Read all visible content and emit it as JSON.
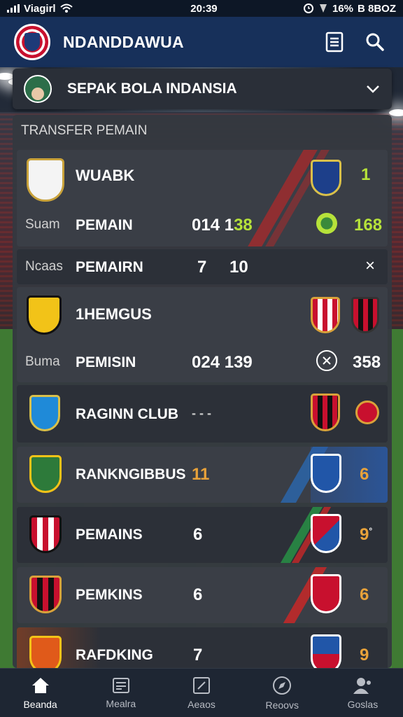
{
  "status_bar": {
    "carrier": "Viagirl",
    "time": "20:39",
    "battery": "16%",
    "right_text": "B 8BOZ"
  },
  "app": {
    "title": "NDANDDAWUA",
    "icons": [
      "clipboard-icon",
      "search-icon"
    ]
  },
  "league": {
    "name": "SEPAK BOLA INDANSIA"
  },
  "section": {
    "title": "TRANSFER PEMAIN"
  },
  "cards": [
    {
      "name": "WUABK",
      "right_value": "1",
      "label_left": "Suam",
      "label": "PEMAIN",
      "mid_a": "014 1",
      "mid_b": "38",
      "right_value2": "168"
    },
    {
      "label_left": "Ncaas",
      "label": "PEMAIRN",
      "mid_a": "7",
      "mid_b": "10",
      "close": "×"
    },
    {
      "name": "1HEMGUS",
      "label_left": "Buma",
      "label": "PEMISIN",
      "mid_a": "024 1",
      "mid_b": "39",
      "right_value2": "358"
    },
    {
      "name": "RAGINN CLUB",
      "mid_a": "- - -"
    },
    {
      "name": "RANKNGIBBUS",
      "mid_a": "11",
      "right_value": "6"
    },
    {
      "name": "PEMAINS",
      "mid_a": "6",
      "right_value": "9",
      "sup": "°"
    },
    {
      "name": "PEMKINS",
      "mid_a": "6",
      "right_value": "6"
    },
    {
      "name": "RAFDKING",
      "mid_a": "7",
      "right_value": "9"
    }
  ],
  "bottom_nav": [
    {
      "label": "Beanda",
      "icon": "home-icon",
      "active": true
    },
    {
      "label": "Mealra",
      "icon": "news-icon",
      "active": false
    },
    {
      "label": "Aeaos",
      "icon": "edit-icon",
      "active": false
    },
    {
      "label": "Reoovs",
      "icon": "compass-icon",
      "active": false
    },
    {
      "label": "Goslas",
      "icon": "user-icon",
      "active": false
    }
  ],
  "colors": {
    "header": "#17305a",
    "accent_green": "#b6e23a",
    "accent_orange": "#e8a23a",
    "panel": "#343840"
  }
}
